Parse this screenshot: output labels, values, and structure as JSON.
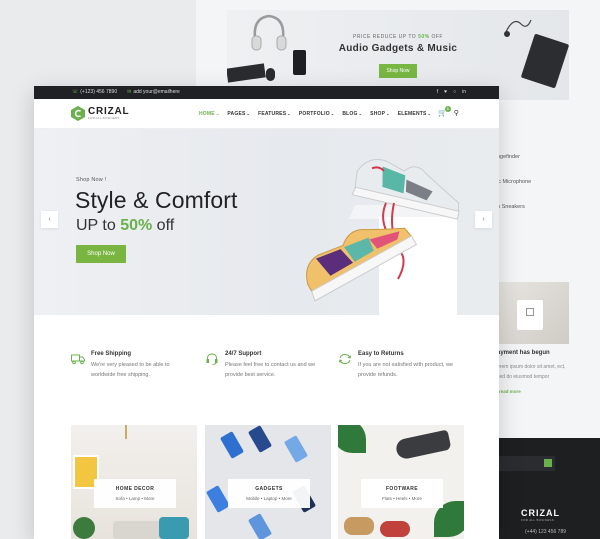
{
  "background": {
    "banner": {
      "kicker": "PRICE REDUCE UP TO",
      "kicker_pct": "50%",
      "kicker_suffix": "OFF",
      "title": "Audio Gadgets & Music",
      "button": "Shop Now"
    },
    "side_list": [
      "ngefinder",
      "ic Microphone",
      "n Sneakers"
    ],
    "blog": {
      "title": "ayment has begun",
      "meta": "orem ipsum dolor sit amet, ect, sed do eiusmod tempor",
      "more": "read more"
    },
    "footer": {
      "logo": "CRIZAL",
      "logo_tagline": "FOR ALL BUSINESS",
      "phone": "(+44) 123 456 789"
    }
  },
  "topbar": {
    "phone": "(+123) 456 7890",
    "email": "add your@emailhere",
    "social": [
      "f",
      "♥",
      "○",
      "in"
    ]
  },
  "header": {
    "logo": "CRIZAL",
    "logo_tagline": "FOR ALL BUSINESS",
    "nav": [
      {
        "label": "HOME",
        "active": true
      },
      {
        "label": "PAGES"
      },
      {
        "label": "FEATURES"
      },
      {
        "label": "PORTFOLIO"
      },
      {
        "label": "BLOG"
      },
      {
        "label": "SHOP"
      },
      {
        "label": "ELEMENTS"
      }
    ],
    "cart_count": "0"
  },
  "hero": {
    "kicker": "Shop Now !",
    "title": "Style & Comfort",
    "sub_prefix": "UP to",
    "sub_highlight": "50%",
    "sub_suffix": "off",
    "button": "Shop Now",
    "prev": "‹",
    "next": "›"
  },
  "features": [
    {
      "icon": "truck-icon",
      "title": "Free Shipping",
      "text": "We're very pleased to be able to worldwide free shipping."
    },
    {
      "icon": "headset-icon",
      "title": "24/7 Support",
      "text": "Please feel free to contact us and we provide best service."
    },
    {
      "icon": "exchange-icon",
      "title": "Easy to Returns",
      "text": "If you are not satisfied with product, we provide refunds."
    }
  ],
  "categories": [
    {
      "name": "HOME DECOR",
      "sub": "Sofa  •  Lamp  •  More"
    },
    {
      "name": "GADGETS",
      "sub": "Mobile  •  Laptop  •  More"
    },
    {
      "name": "FOOTWARE",
      "sub": "Flats  •  Heels  •  More"
    }
  ],
  "colors": {
    "accent": "#6ab04c",
    "topbar": "#1f2124"
  }
}
